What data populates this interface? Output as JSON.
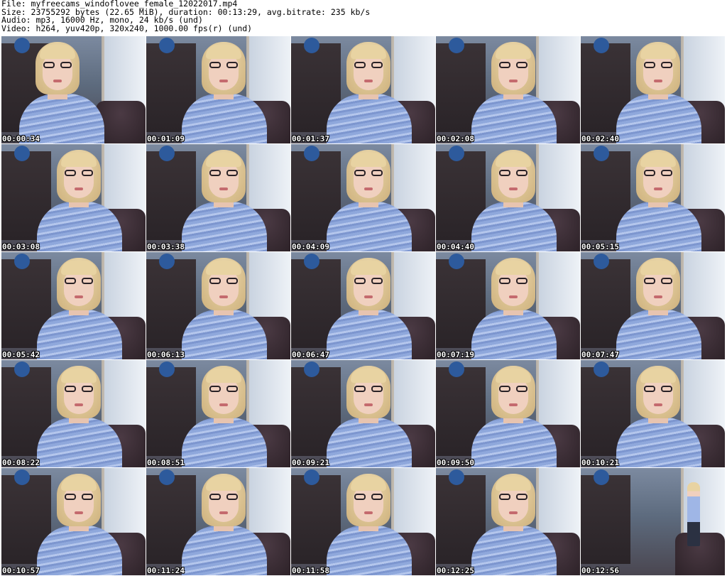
{
  "header": {
    "file_line": "File: myfreecams_windoflovee_female_12022017.mp4",
    "size_line": "Size: 23755292 bytes (22.65 MiB), duration: 00:13:29, avg.bitrate: 235 kb/s",
    "audio_line": "Audio: mp3, 16000 Hz, mono, 24 kb/s (und)",
    "video_line": "Video: h264, yuv420p, 320x240, 1000.00 fps(r) (und)"
  },
  "thumbnails": [
    {
      "timestamp": "00:00:34",
      "variant": "shift-l"
    },
    {
      "timestamp": "00:01:09",
      "variant": ""
    },
    {
      "timestamp": "00:01:37",
      "variant": ""
    },
    {
      "timestamp": "00:02:08",
      "variant": ""
    },
    {
      "timestamp": "00:02:40",
      "variant": ""
    },
    {
      "timestamp": "00:03:08",
      "variant": ""
    },
    {
      "timestamp": "00:03:38",
      "variant": ""
    },
    {
      "timestamp": "00:04:09",
      "variant": ""
    },
    {
      "timestamp": "00:04:40",
      "variant": ""
    },
    {
      "timestamp": "00:05:15",
      "variant": ""
    },
    {
      "timestamp": "00:05:42",
      "variant": ""
    },
    {
      "timestamp": "00:06:13",
      "variant": ""
    },
    {
      "timestamp": "00:06:47",
      "variant": ""
    },
    {
      "timestamp": "00:07:19",
      "variant": ""
    },
    {
      "timestamp": "00:07:47",
      "variant": ""
    },
    {
      "timestamp": "00:08:22",
      "variant": ""
    },
    {
      "timestamp": "00:08:51",
      "variant": ""
    },
    {
      "timestamp": "00:09:21",
      "variant": ""
    },
    {
      "timestamp": "00:09:50",
      "variant": ""
    },
    {
      "timestamp": "00:10:21",
      "variant": ""
    },
    {
      "timestamp": "00:10:57",
      "variant": ""
    },
    {
      "timestamp": "00:11:24",
      "variant": ""
    },
    {
      "timestamp": "00:11:58",
      "variant": ""
    },
    {
      "timestamp": "00:12:25",
      "variant": ""
    },
    {
      "timestamp": "00:12:56",
      "variant": "far"
    }
  ]
}
